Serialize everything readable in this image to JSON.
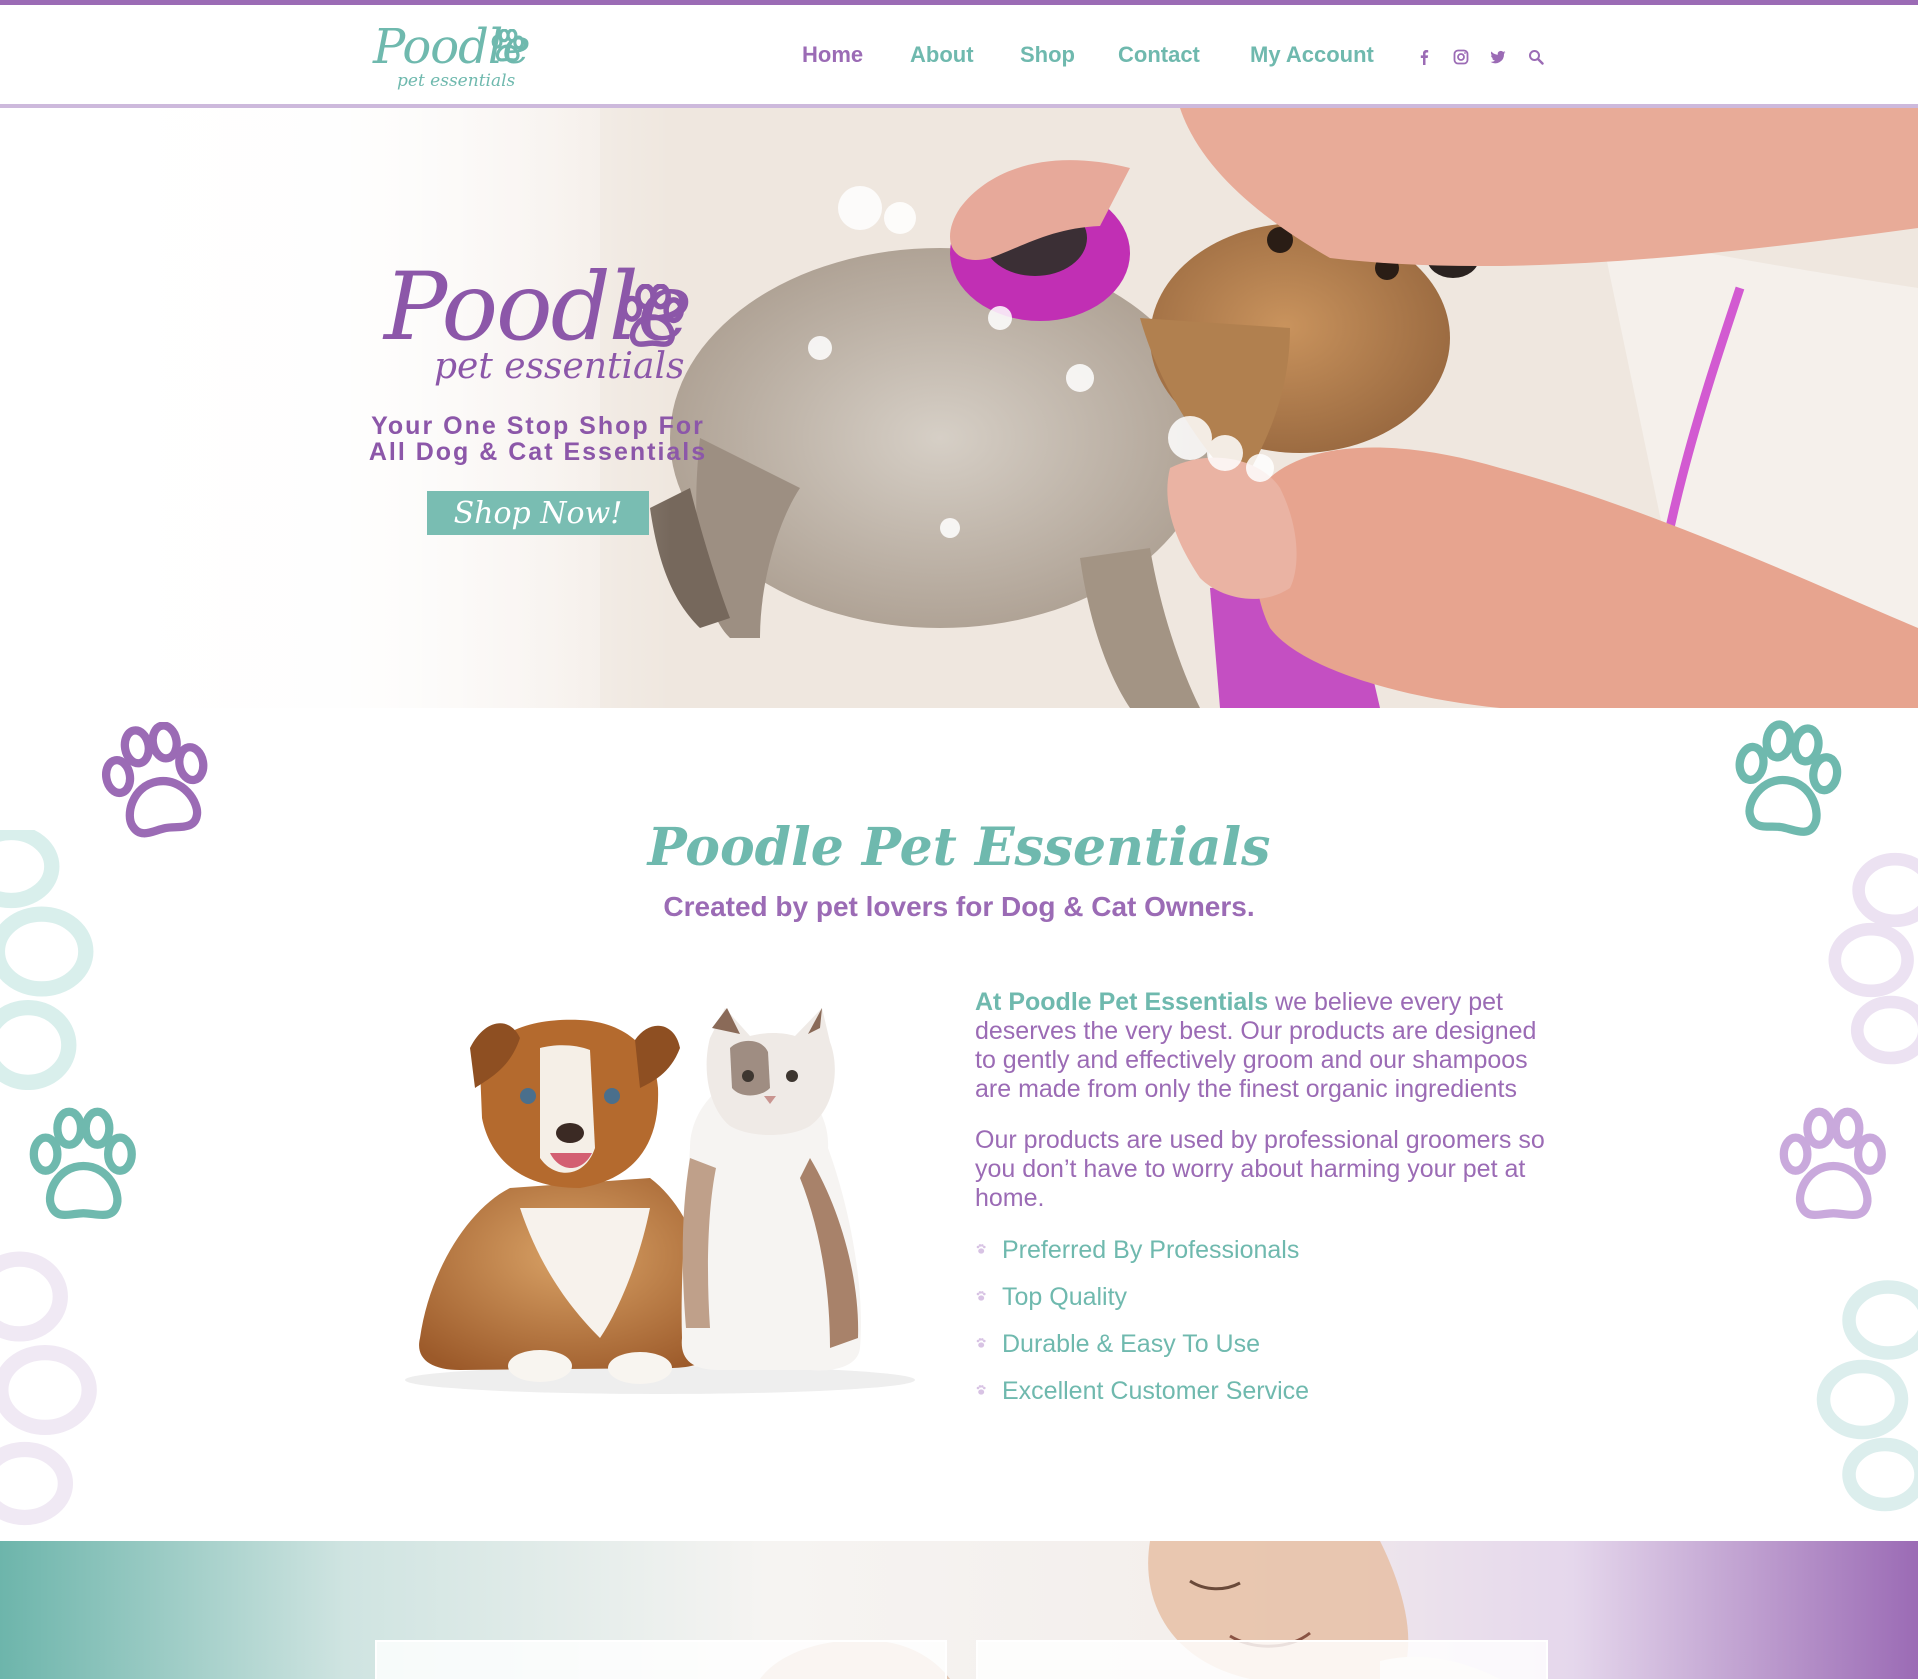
{
  "header": {
    "logo": {
      "word": "Poodle",
      "sub": "pet essentials"
    },
    "nav": [
      {
        "label": "Home",
        "active": true
      },
      {
        "label": "About",
        "active": false
      },
      {
        "label": "Shop",
        "active": false
      },
      {
        "label": "Contact",
        "active": false
      },
      {
        "label": "My Account",
        "active": false
      }
    ],
    "social_icons": [
      "facebook-icon",
      "instagram-icon",
      "twitter-icon",
      "search-icon"
    ]
  },
  "hero": {
    "logo": {
      "word": "Poodle",
      "sub": "pet essentials"
    },
    "tagline_line1": "Your One Stop Shop For",
    "tagline_line2": "All Dog & Cat Essentials",
    "button_label": "Shop Now!"
  },
  "intro": {
    "title": "Poodle Pet Essentials",
    "subtitle": "Created by pet lovers for Dog & Cat Owners.",
    "para1_lead": "At Poodle Pet Essentials",
    "para1_rest": " we believe every pet deserves the very best. Our products are designed to gently and effectively groom and our shampoos are made from only the finest organic ingredients",
    "para2": "Our products are used by professional groomers so you don’t have to worry about harming your pet at home.",
    "features": [
      "Preferred By Professionals",
      "Top Quality",
      "Durable & Easy To Use",
      "Excellent Customer Service"
    ]
  },
  "colors": {
    "purple": "#9b6bb5",
    "teal": "#6fb9ae",
    "button": "#79bdb2"
  }
}
